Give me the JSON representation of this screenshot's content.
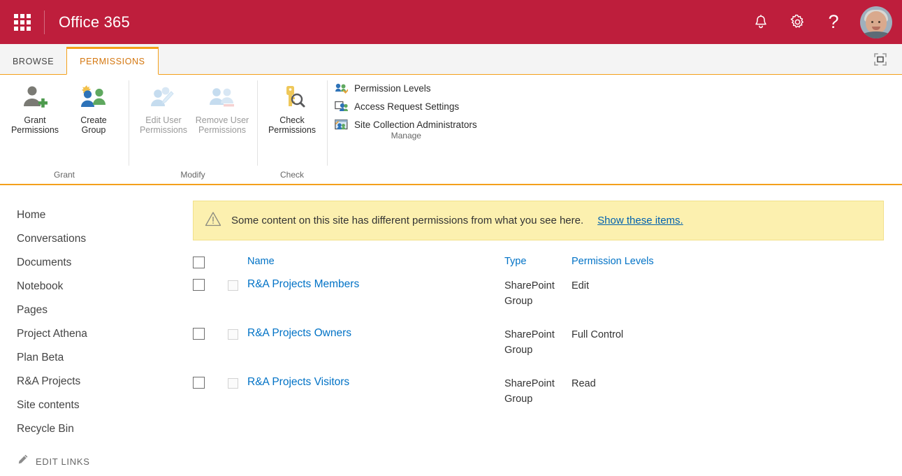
{
  "suite": {
    "app_launcher": "app-launcher",
    "title": "Office 365",
    "notifications_icon": "bell-icon",
    "settings_icon": "gear-icon",
    "help_icon": "help-icon",
    "help_glyph": "?",
    "avatar": "user-avatar"
  },
  "ribbon": {
    "tabs": [
      {
        "label": "BROWSE",
        "active": false
      },
      {
        "label": "PERMISSIONS",
        "active": true
      }
    ],
    "focus_on_content_icon": "focus-on-content-icon",
    "groups": [
      {
        "name": "Grant",
        "label": "Grant",
        "buttons": [
          {
            "label": "Grant\nPermissions",
            "line1": "Grant",
            "line2": "Permissions",
            "icon": "grant-permissions-icon",
            "disabled": false
          },
          {
            "label": "Create\nGroup",
            "line1": "Create",
            "line2": "Group",
            "icon": "create-group-icon",
            "disabled": false
          }
        ]
      },
      {
        "name": "Modify",
        "label": "Modify",
        "buttons": [
          {
            "line1": "Edit User",
            "line2": "Permissions",
            "icon": "edit-user-permissions-icon",
            "disabled": true
          },
          {
            "line1": "Remove User",
            "line2": "Permissions",
            "icon": "remove-user-permissions-icon",
            "disabled": true
          }
        ]
      },
      {
        "name": "Check",
        "label": "Check",
        "buttons": [
          {
            "line1": "Check",
            "line2": "Permissions",
            "icon": "check-permissions-icon",
            "disabled": false
          }
        ]
      },
      {
        "name": "Manage",
        "label": "Manage",
        "items": [
          {
            "label": "Permission Levels",
            "icon": "permission-levels-icon"
          },
          {
            "label": "Access Request Settings",
            "icon": "access-request-settings-icon"
          },
          {
            "label": "Site Collection Administrators",
            "icon": "site-collection-administrators-icon"
          }
        ]
      }
    ]
  },
  "sidebar": {
    "items": [
      {
        "label": "Home"
      },
      {
        "label": "Conversations"
      },
      {
        "label": "Documents"
      },
      {
        "label": "Notebook"
      },
      {
        "label": "Pages"
      },
      {
        "label": "Project Athena"
      },
      {
        "label": "Plan Beta"
      },
      {
        "label": "R&A Projects"
      },
      {
        "label": "Site contents"
      },
      {
        "label": "Recycle Bin"
      }
    ],
    "edit_links": {
      "label": "EDIT LINKS",
      "icon": "pencil-icon"
    }
  },
  "banner": {
    "icon": "warning-triangle-icon",
    "message": "Some content on this site has different permissions from what you see here.",
    "link": "Show these items."
  },
  "table": {
    "select_all_checkbox": "select-all-checkbox",
    "columns": [
      {
        "label": "Name"
      },
      {
        "label": "Type"
      },
      {
        "label": "Permission Levels"
      }
    ],
    "rows": [
      {
        "name": "R&A Projects Members",
        "type": "SharePoint Group",
        "levels": "Edit"
      },
      {
        "name": "R&A Projects Owners",
        "type": "SharePoint Group",
        "levels": "Full Control"
      },
      {
        "name": "R&A Projects Visitors",
        "type": "SharePoint Group",
        "levels": "Read"
      }
    ]
  },
  "colors": {
    "suite_bar": "#BE1E3C",
    "tab_accent": "#F4A01B",
    "link": "#0072C6",
    "banner_bg": "#FCF0AF"
  }
}
